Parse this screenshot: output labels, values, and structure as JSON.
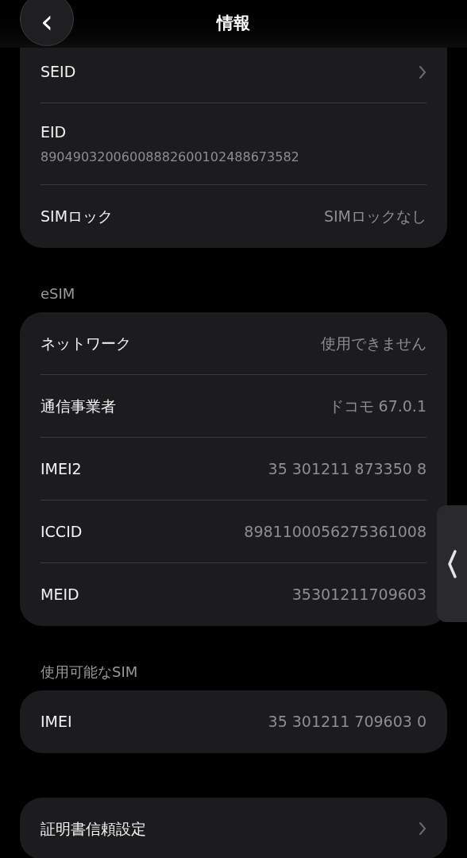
{
  "header": {
    "title": "情報",
    "back": "‹"
  },
  "sections": [
    {
      "rows": [
        {
          "kind": "link",
          "label": "SEID"
        },
        {
          "kind": "stacked",
          "label": "EID",
          "value": "89049032006008882600102488673582"
        },
        {
          "kind": "value",
          "label": "SIMロック",
          "value": "SIMロックなし"
        }
      ]
    },
    {
      "title": "eSIM",
      "rows": [
        {
          "kind": "value",
          "label": "ネットワーク",
          "value": "使用できません"
        },
        {
          "kind": "value",
          "label": "通信事業者",
          "value": "ドコモ 67.0.1"
        },
        {
          "kind": "value",
          "label": "IMEI2",
          "value": "35 301211 873350 8"
        },
        {
          "kind": "value",
          "label": "ICCID",
          "value": "8981100056275361008"
        },
        {
          "kind": "value",
          "label": "MEID",
          "value": "35301211709603"
        }
      ]
    },
    {
      "title": "使用可能なSIM",
      "rows": [
        {
          "kind": "value",
          "label": "IMEI",
          "value": "35 301211 709603 0"
        }
      ]
    },
    {
      "rows": [
        {
          "kind": "link",
          "label": "証明書信頼設定"
        }
      ]
    }
  ]
}
